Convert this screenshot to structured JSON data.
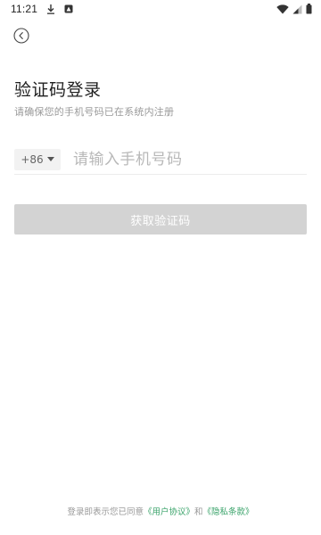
{
  "status_bar": {
    "time": "11:21",
    "left_icons": [
      "download-icon",
      "image-notification-icon"
    ],
    "right_icons": [
      "wifi-icon",
      "signal-icon",
      "battery-icon"
    ]
  },
  "header": {
    "back_icon": "chevron-left-circle-icon"
  },
  "login": {
    "title": "验证码登录",
    "subtitle": "请确保您的手机号码已在系统内注册",
    "country_code": "+86",
    "phone_placeholder": "请输入手机号码",
    "phone_value": "",
    "get_code_label": "获取验证码"
  },
  "footer": {
    "prefix": "登录即表示您已同意",
    "user_agreement": "《用户协议》",
    "conjunction": "和",
    "privacy_policy": "《隐私条款》"
  },
  "colors": {
    "accent_link": "#3aa36a",
    "button_disabled": "#d3d3d3",
    "placeholder": "#b8b8b8"
  }
}
